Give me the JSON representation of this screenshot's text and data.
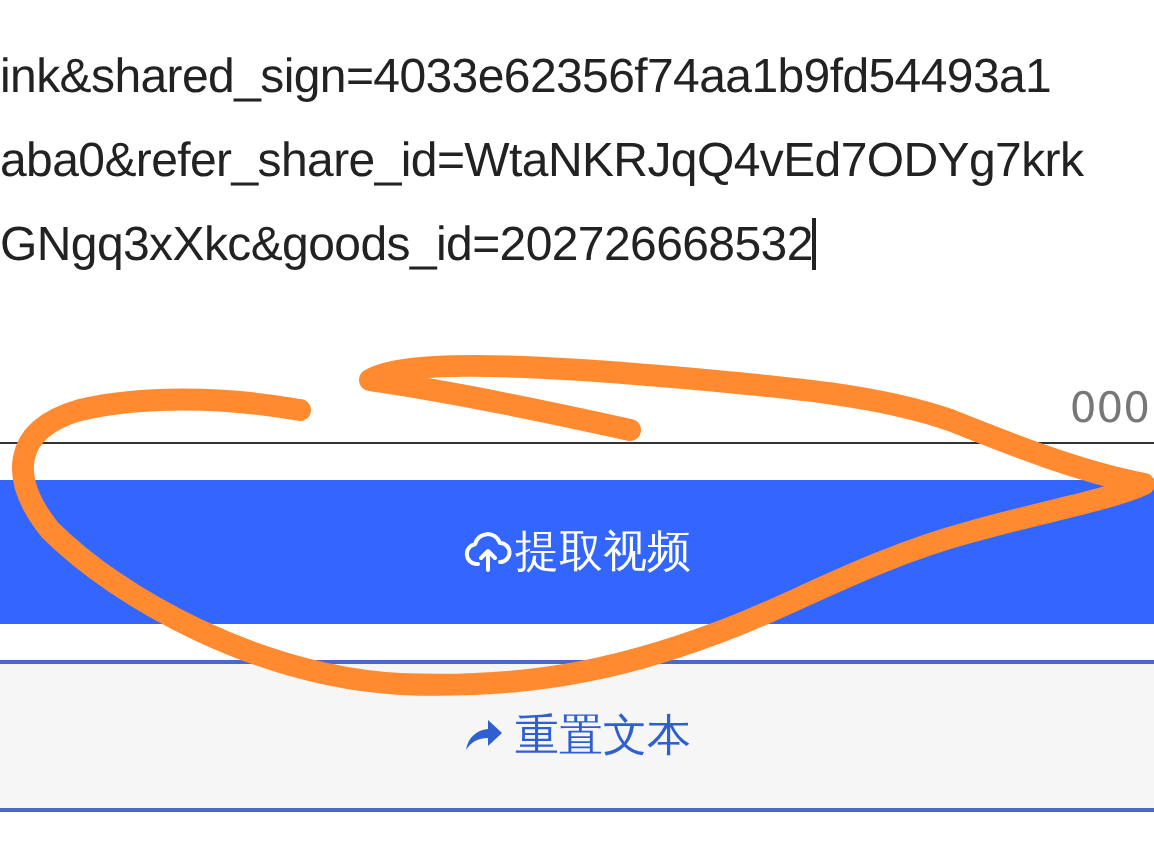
{
  "text_area": {
    "lines": [
      "ink&shared_sign=4033e62356f74aa1b9fd54493a1",
      "aba0&refer_share_id=WtaNKRJqQ4vEd7ODYg7krk",
      "GNgq3xXkc&goods_id=202726668532"
    ],
    "counter": "000"
  },
  "buttons": [
    {
      "kind": "primary",
      "label": "提取视频"
    },
    {
      "kind": "secondary",
      "label": "重置文本"
    }
  ]
}
